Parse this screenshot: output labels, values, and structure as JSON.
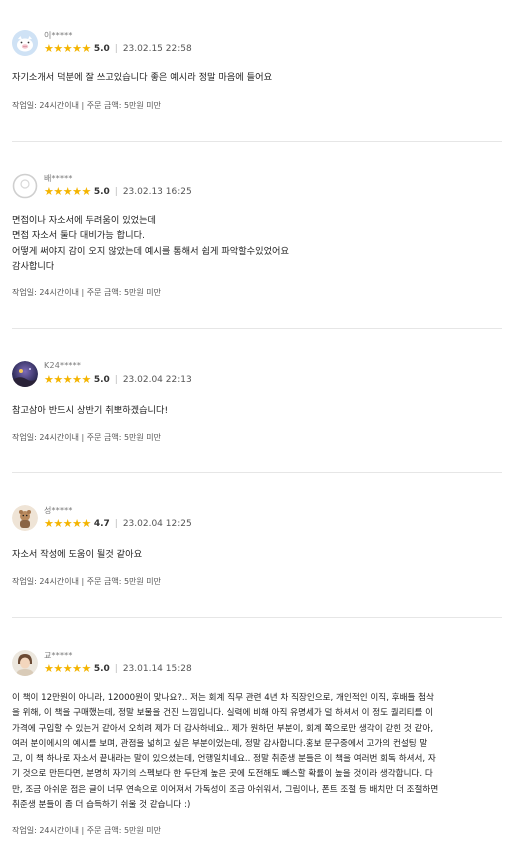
{
  "reviews": [
    {
      "user": "이*****",
      "stars": "★★★★★",
      "score": "5.0",
      "date": "23.02.15 22:58",
      "content": "자기소개서 덕분에 잘 쓰고있습니다 좋은 예시라 정말 마음에 들어요",
      "meta": "작업일: 24시간이내 | 주문 금액: 5만원 미만",
      "avatar_icon": "pig-icon"
    },
    {
      "user": "배*****",
      "stars": "★★★★★",
      "score": "5.0",
      "date": "23.02.13 16:25",
      "content": "면접이나 자소서에 두려움이 있었는데\n면접 자소서 둘다 대비가능 합니다.\n어떻게 써야지 감이 오지 않았는데 예시를 통해서 쉽게 파악할수있었어요\n감사합니다",
      "meta": "작업일: 24시간이내 | 주문 금액: 5만원 미만",
      "avatar_icon": "default-user-icon"
    },
    {
      "user": "K24*****",
      "stars": "★★★★★",
      "score": "5.0",
      "date": "23.02.04 22:13",
      "content": "참고삼아 반드시 상반기 취뽀하겠습니다!",
      "meta": "작업일: 24시간이내 | 주문 금액: 5만원 미만",
      "avatar_icon": "night-photo-icon"
    },
    {
      "user": "성*****",
      "stars": "★★★★★",
      "score": "4.7",
      "date": "23.02.04 12:25",
      "content": "자소서 작성에 도움이 될것 같아요",
      "meta": "작업일: 24시간이내 | 주문 금액: 5만원 미만",
      "avatar_icon": "bear-figure-icon"
    },
    {
      "user": "교*****",
      "stars": "★★★★★",
      "score": "5.0",
      "date": "23.01.14 15:28",
      "content": "이 책이 12만원이 아니라, 12000원이 맞나요?.. 저는 회계 직무 관련 4년 차 직장인으로, 개인적인 이직, 후배들 첨삭\n을 위해, 이 책을 구매했는데, 정말 보물을 건진 느낌입니다. 실력에 비해 아직 유명세가 덜 하셔서 이 정도 퀄리티를 이\n가격에 구입할 수 있는거 같아서 오히려 제가 더 감사하네요.. 제가 원하던 부분이, 회계 쪽으로만 생각이 갇힌 것 같아,\n여러 분이에시의 예시를 보며, 관점을 넓히고 싶은 부분이었는데, 정말 감사합니다.홍보 문구중에서 고가의 컨설팅 말\n고, 이 책 하나로 자소서 끝내라는 말이 있으셨는데, 언행일치네요.. 정말 취준생 분들은 이 책을 여러번 회독 하셔서, 자\n기 것으로 만든다면, 분명히 자기의 스펙보다 한 두단계 높은 곳에 도전해도 빼스할 확률이 높을 것이라 생각합니다. 다\n만, 조금 아쉬운 점은 글이 너무 연속으로 이어져서 가독성이 조금 아쉬워서, 그림이나, 폰트 조절 등 배치만 더 조절하면\n취준생 분들이 좀 더 습득하기 쉬울 것 같습니다 :)",
      "meta": "작업일: 24시간이내 | 주문 금액: 5만원 미만",
      "avatar_icon": "profile-photo-icon"
    }
  ]
}
